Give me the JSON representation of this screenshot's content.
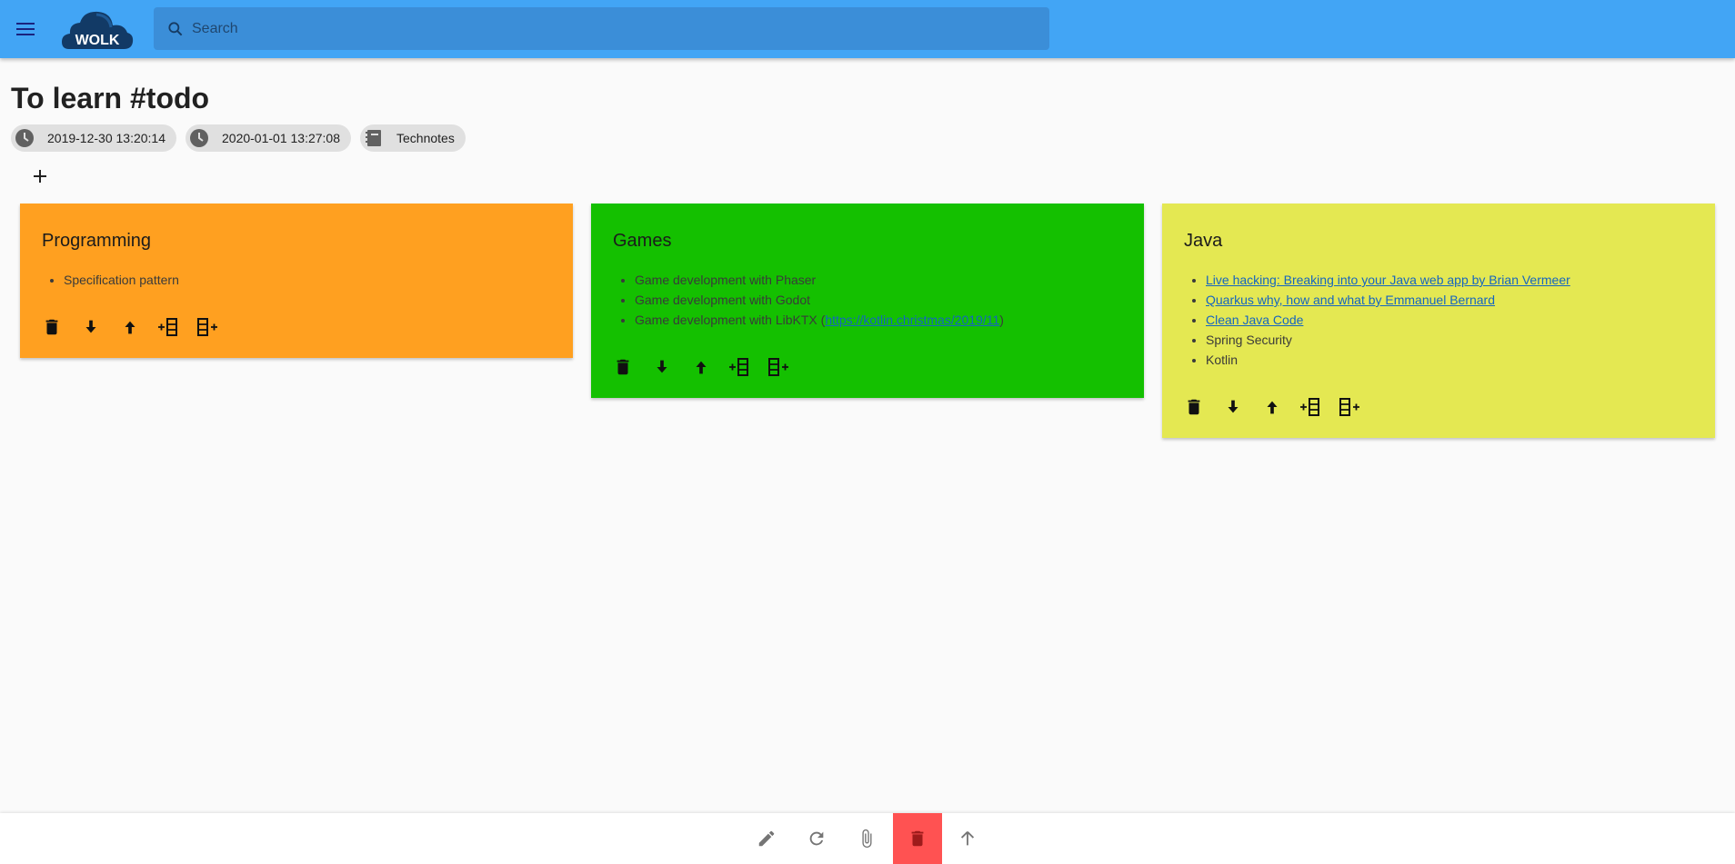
{
  "app": {
    "name": "WOLK",
    "brand_color": "#42a5f5"
  },
  "search": {
    "placeholder": "Search",
    "value": ""
  },
  "note": {
    "title": "To learn #todo",
    "created": "2019-12-30 13:20:14",
    "modified": "2020-01-01 13:27:08",
    "notebook": "Technotes"
  },
  "icons": {
    "menu": "hamburger-icon",
    "search": "magnifier-icon",
    "created": "clock-icon",
    "modified": "clock-icon",
    "notebook": "notebook-icon",
    "add": "plus-icon"
  },
  "cards": [
    {
      "title": "Programming",
      "color": "#ffa020",
      "items": [
        {
          "text": "Specification pattern",
          "link": false
        }
      ],
      "actions": [
        "delete-icon",
        "move-down-icon",
        "move-up-icon",
        "add-column-before-icon",
        "add-column-after-icon"
      ]
    },
    {
      "title": "Games",
      "color": "#14c000",
      "items": [
        {
          "text": "Game development with Phaser",
          "link": false
        },
        {
          "text": "Game development with Godot",
          "link": false
        },
        {
          "text": "Game development with LibKTX (",
          "link_text": "https://kotlin.christmas/2019/11",
          "suffix": ")",
          "link": "partial"
        }
      ],
      "actions": [
        "delete-icon",
        "move-down-icon",
        "move-up-icon",
        "add-column-before-icon",
        "add-column-after-icon"
      ]
    },
    {
      "title": "Java",
      "color": "#e4e852",
      "items": [
        {
          "text": "Live hacking: Breaking into your Java web app by Brian Vermeer",
          "link": true
        },
        {
          "text": "Quarkus why, how and what by Emmanuel Bernard",
          "link": true
        },
        {
          "text": "Clean Java Code",
          "link": true
        },
        {
          "text": "Spring Security",
          "link": false
        },
        {
          "text": "Kotlin",
          "link": false
        }
      ],
      "actions": [
        "delete-icon",
        "move-down-icon",
        "move-up-icon",
        "add-column-before-icon",
        "add-column-after-icon"
      ]
    }
  ],
  "bottom_bar": {
    "buttons": [
      "pencil-icon",
      "refresh-icon",
      "paperclip-icon",
      "trash-icon",
      "arrow-up-icon"
    ],
    "danger_color": "#ff5252"
  }
}
